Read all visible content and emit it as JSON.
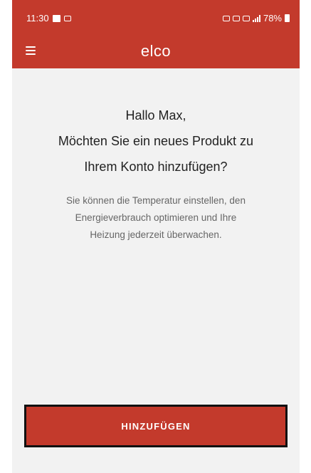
{
  "status_bar": {
    "time": "11:30",
    "battery": "78%"
  },
  "header": {
    "brand": "elco",
    "menu_icon": "hamburger-menu-icon"
  },
  "main": {
    "greeting_line1": "Hallo Max,",
    "greeting_line2": "Möchten Sie ein neues Produkt zu",
    "greeting_line3": "Ihrem Konto hinzufügen?",
    "desc_line1": "Sie können die Temperatur einstellen, den",
    "desc_line2": "Energieverbrauch optimieren und Ihre",
    "desc_line3": "Heizung jederzeit überwachen."
  },
  "actions": {
    "add_label": "HINZUFÜGEN"
  },
  "colors": {
    "brand_red": "#c33a2c",
    "background": "#f2f2f2"
  }
}
